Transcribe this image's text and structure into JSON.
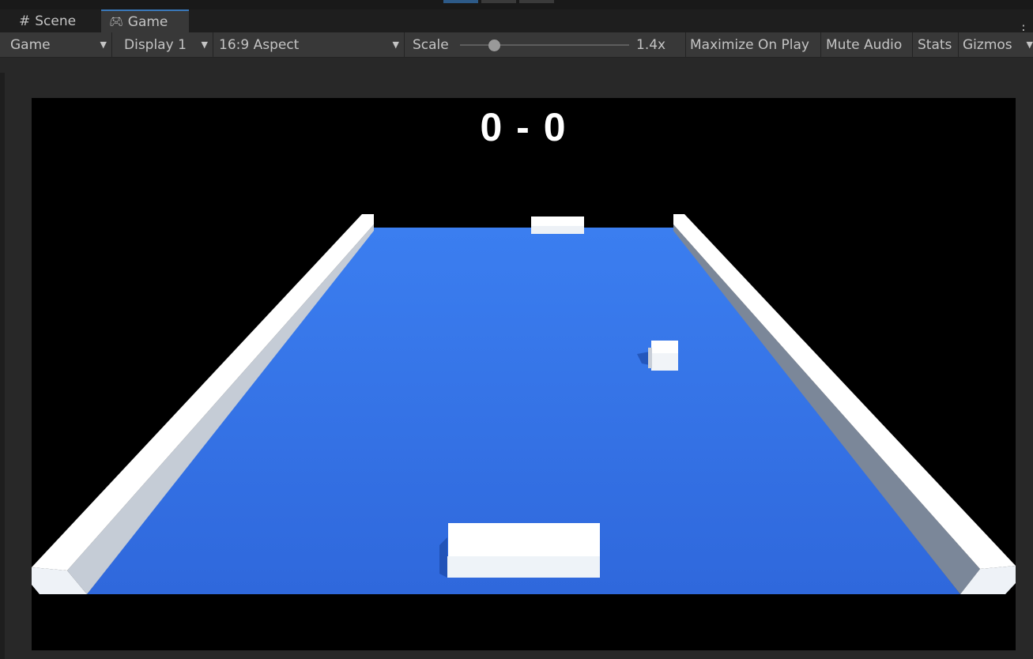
{
  "tabs": [
    {
      "label": "Scene",
      "icon": "hash-icon"
    },
    {
      "label": "Game",
      "icon": "gamepad-icon",
      "active": true
    }
  ],
  "toolbar": {
    "display_mode": "Game",
    "display": "Display 1",
    "aspect": "16:9 Aspect",
    "scale_label": "Scale",
    "scale_value": "1.4x",
    "scale_fraction": 0.2,
    "maximize": "Maximize On Play",
    "mute": "Mute Audio",
    "stats": "Stats",
    "gizmos": "Gizmos"
  },
  "game": {
    "score": "0 - 0",
    "floor_color": "#306de0",
    "wall_color": "#ffffff"
  }
}
